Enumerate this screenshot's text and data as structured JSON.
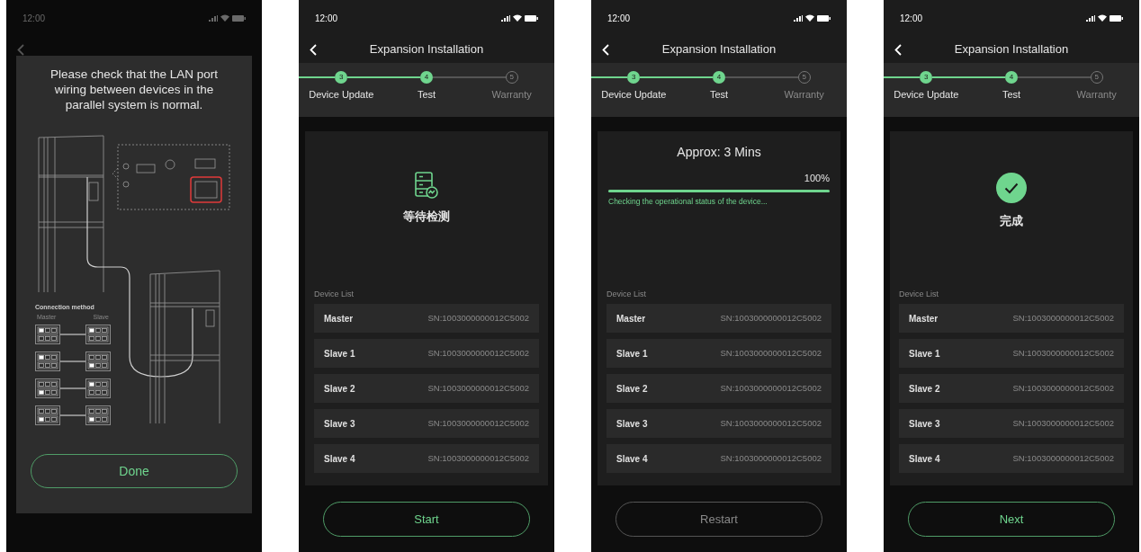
{
  "phones": [
    {
      "kind": "dialog",
      "time": "12:00",
      "dialog": {
        "message": "Please check that the LAN port wiring between devices in the parallel system is normal.",
        "connection": {
          "title": "Connection method",
          "master_label": "Master",
          "slave_label": "Slave",
          "pairs": [
            {
              "master_top": true,
              "slave_top": true
            },
            {
              "master_top": true,
              "slave_top": false
            },
            {
              "master_top": false,
              "slave_top": true
            },
            {
              "master_top": false,
              "slave_top": false
            }
          ]
        },
        "button": "Done"
      }
    },
    {
      "kind": "screen",
      "time": "12:00",
      "title": "Expansion Installation",
      "steps": [
        {
          "number": "3",
          "label": "Device Update",
          "active": true
        },
        {
          "number": "4",
          "label": "Test",
          "active": true
        },
        {
          "number": "5",
          "label": "Warranty",
          "active": false
        }
      ],
      "status": {
        "kind": "waiting",
        "label": "等待检测"
      },
      "device_list": {
        "title": "Device List",
        "rows": [
          {
            "name": "Master",
            "sn": "SN:1003000000012C5002"
          },
          {
            "name": "Slave 1",
            "sn": "SN:1003000000012C5002"
          },
          {
            "name": "Slave 2",
            "sn": "SN:1003000000012C5002"
          },
          {
            "name": "Slave 3",
            "sn": "SN:1003000000012C5002"
          },
          {
            "name": "Slave 4",
            "sn": "SN:1003000000012C5002"
          }
        ]
      },
      "button": {
        "label": "Start",
        "disabled": false
      }
    },
    {
      "kind": "screen",
      "time": "12:00",
      "title": "Expansion Installation",
      "steps": [
        {
          "number": "3",
          "label": "Device Update",
          "active": true
        },
        {
          "number": "4",
          "label": "Test",
          "active": true
        },
        {
          "number": "5",
          "label": "Warranty",
          "active": false
        }
      ],
      "status": {
        "kind": "progress",
        "title": "Approx: 3 Mins",
        "percent": "100%",
        "level": 1,
        "message": "Checking the operational status of the device..."
      },
      "device_list": {
        "title": "Device List",
        "rows": [
          {
            "name": "Master",
            "sn": "SN:1003000000012C5002"
          },
          {
            "name": "Slave 1",
            "sn": "SN:1003000000012C5002"
          },
          {
            "name": "Slave 2",
            "sn": "SN:1003000000012C5002"
          },
          {
            "name": "Slave 3",
            "sn": "SN:1003000000012C5002"
          },
          {
            "name": "Slave 4",
            "sn": "SN:1003000000012C5002"
          }
        ]
      },
      "button": {
        "label": "Restart",
        "disabled": true
      }
    },
    {
      "kind": "screen",
      "time": "12:00",
      "title": "Expansion Installation",
      "steps": [
        {
          "number": "3",
          "label": "Device Update",
          "active": true
        },
        {
          "number": "4",
          "label": "Test",
          "active": true
        },
        {
          "number": "5",
          "label": "Warranty",
          "active": false
        }
      ],
      "status": {
        "kind": "done",
        "label": "完成"
      },
      "device_list": {
        "title": "Device List",
        "rows": [
          {
            "name": "Master",
            "sn": "SN:1003000000012C5002"
          },
          {
            "name": "Slave 1",
            "sn": "SN:1003000000012C5002"
          },
          {
            "name": "Slave 2",
            "sn": "SN:1003000000012C5002"
          },
          {
            "name": "Slave 3",
            "sn": "SN:1003000000012C5002"
          },
          {
            "name": "Slave 4",
            "sn": "SN:1003000000012C5002"
          }
        ]
      },
      "button": {
        "label": "Next",
        "disabled": false
      }
    }
  ]
}
